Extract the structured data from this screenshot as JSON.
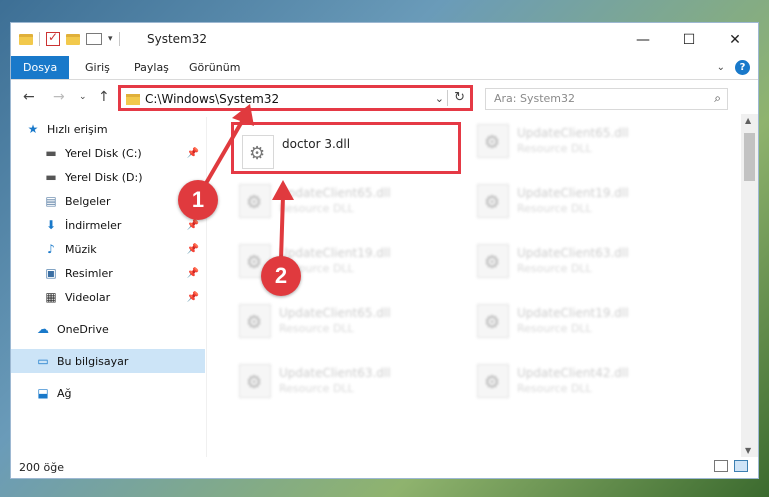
{
  "window": {
    "title": "System32"
  },
  "ribbon": {
    "tabs": [
      {
        "label": "Dosya",
        "active": true
      },
      {
        "label": "Giriş"
      },
      {
        "label": "Paylaş"
      },
      {
        "label": "Görünüm"
      }
    ],
    "help_label": "?"
  },
  "nav": {
    "address": "C:\\Windows\\System32",
    "search_placeholder": "Ara: System32"
  },
  "sidebar": {
    "items": [
      {
        "label": "Hızlı erişim",
        "icon": "star-icon"
      },
      {
        "label": "Yerel Disk (C:)",
        "icon": "drive-icon",
        "pinned": true
      },
      {
        "label": "Yerel Disk (D:)",
        "icon": "drive-icon"
      },
      {
        "label": "Belgeler",
        "icon": "documents-icon",
        "pinned": true
      },
      {
        "label": "İndirmeler",
        "icon": "download-icon",
        "pinned": true
      },
      {
        "label": "Müzik",
        "icon": "music-icon",
        "pinned": true
      },
      {
        "label": "Resimler",
        "icon": "pictures-icon",
        "pinned": true
      },
      {
        "label": "Videolar",
        "icon": "videos-icon",
        "pinned": true
      },
      {
        "label": "OneDrive",
        "icon": "cloud-icon"
      },
      {
        "label": "Bu bilgisayar",
        "icon": "computer-icon",
        "selected": true
      },
      {
        "label": "Ağ",
        "icon": "network-icon"
      }
    ]
  },
  "files": [
    {
      "name": "doctor 3.dll",
      "type": "",
      "highlight": true
    },
    {
      "name": "UpdateClient65.dll",
      "type": "Resource DLL"
    },
    {
      "name": "UpdateClient65.dll",
      "type": "Resource DLL"
    },
    {
      "name": "UpdateClient19.dll",
      "type": "Resource DLL"
    },
    {
      "name": "UpdateClient19.dll",
      "type": "Resource DLL"
    },
    {
      "name": "UpdateClient63.dll",
      "type": "Resource DLL"
    },
    {
      "name": "UpdateClient65.dll",
      "type": "Resource DLL"
    },
    {
      "name": "UpdateClient19.dll",
      "type": "Resource DLL"
    },
    {
      "name": "UpdateClient63.dll",
      "type": "Resource DLL"
    },
    {
      "name": "UpdateClient42.dll",
      "type": "Resource DLL"
    }
  ],
  "status": {
    "count": "200 öğe"
  },
  "annotations": [
    {
      "label": "1"
    },
    {
      "label": "2"
    }
  ],
  "colors": {
    "accent": "#1979ca",
    "highlight": "#e53945"
  }
}
